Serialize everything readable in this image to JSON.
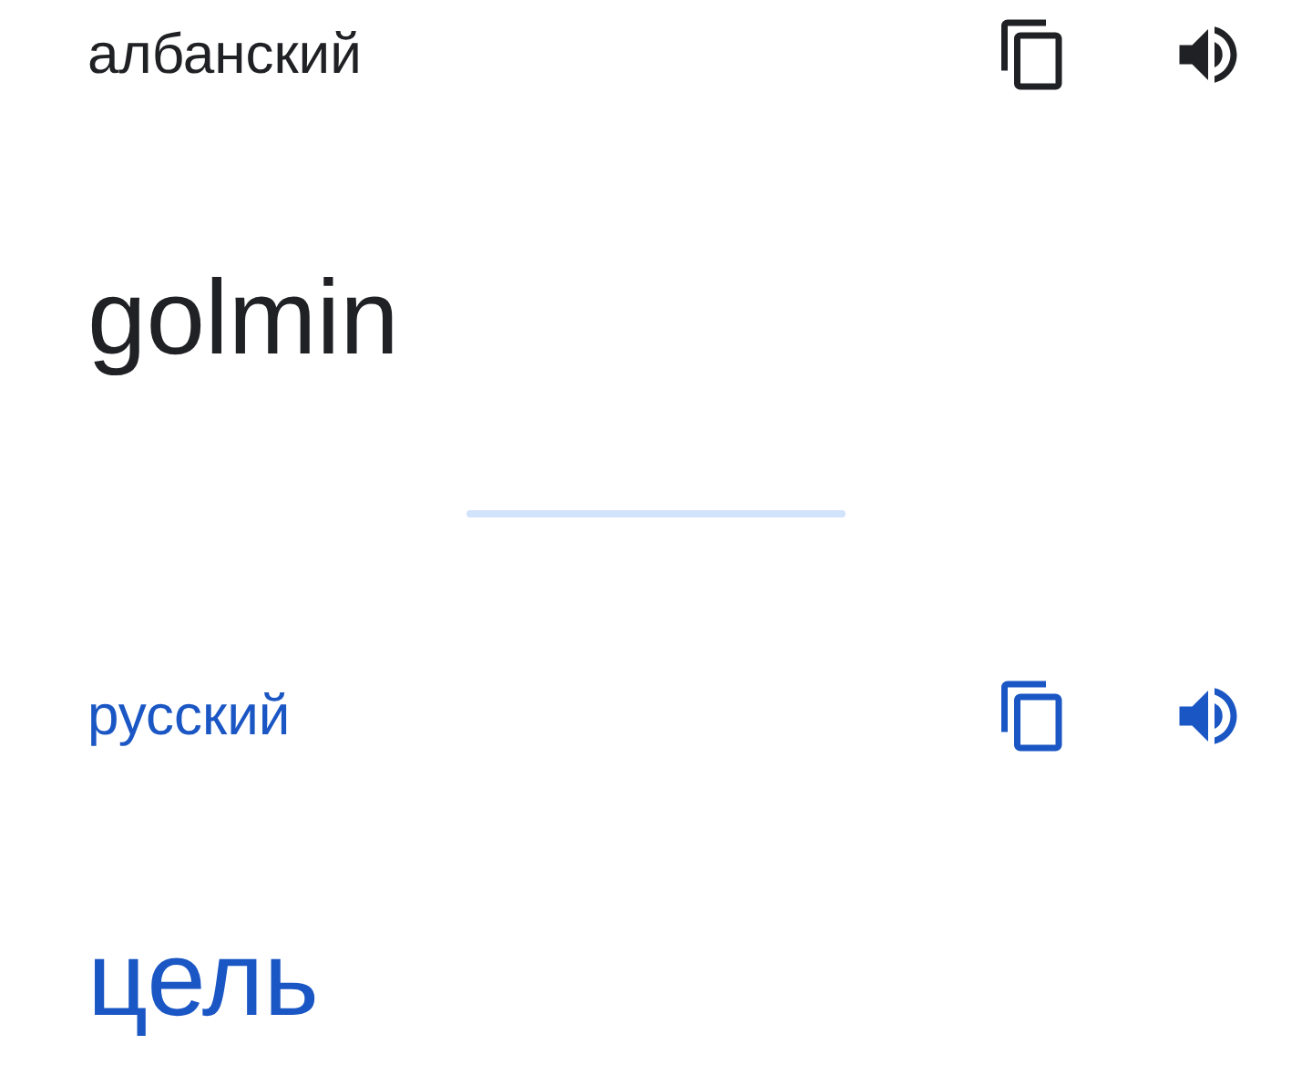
{
  "source": {
    "language": "албанский",
    "text": "golmin"
  },
  "target": {
    "language": "русский",
    "text": "цель"
  }
}
